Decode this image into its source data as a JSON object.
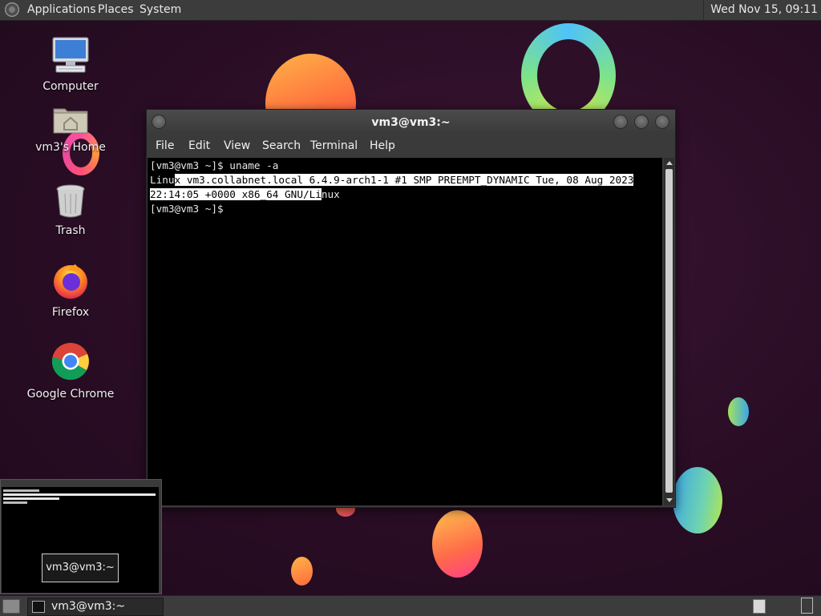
{
  "top_panel": {
    "menus": [
      "Applications",
      "Places",
      "System"
    ],
    "clock": "Wed Nov 15, 09:11"
  },
  "desktop": {
    "icons": [
      {
        "label": "Computer",
        "icon": "computer-icon"
      },
      {
        "label": "vm3's Home",
        "icon": "home-folder-icon"
      },
      {
        "label": "Trash",
        "icon": "trash-icon"
      },
      {
        "label": "Firefox",
        "icon": "firefox-icon"
      },
      {
        "label": "Google Chrome",
        "icon": "chrome-icon"
      }
    ]
  },
  "terminal": {
    "title": "vm3@vm3:~",
    "menus": [
      "File",
      "Edit",
      "View",
      "Search",
      "Terminal",
      "Help"
    ],
    "lines": {
      "l1": "[vm3@vm3 ~]$ uname -a",
      "l2_a": "Linu",
      "l2_b": "x vm3.collabnet.local 6.4.9-arch1-1 #1 SMP PREEMPT_DYNAMIC Tue, 08 Aug 2023",
      "l3_a": "22:14:05 +0000 x86_64 GNU/Li",
      "l3_b": "nux",
      "l4": "[vm3@vm3 ~]$"
    }
  },
  "preview": {
    "label": "vm3@vm3:~"
  },
  "taskbar": {
    "task_label": "vm3@vm3:~"
  },
  "colors": {
    "panel": "#3c3c3c",
    "terminal_bg": "#000000",
    "selection": "#ffffff"
  }
}
